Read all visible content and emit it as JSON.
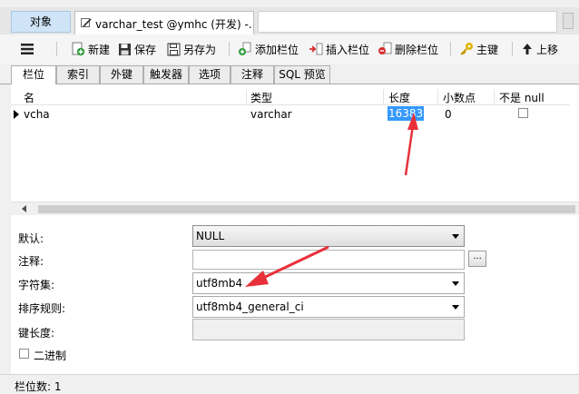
{
  "tabbar": {
    "objects_tab": "对象",
    "doc_tab": "varchar_test @ymhc (开发) -..."
  },
  "toolbar": {
    "new": "新建",
    "save": "保存",
    "save_as": "另存为",
    "add_field": "添加栏位",
    "insert_field": "插入栏位",
    "delete_field": "删除栏位",
    "primary_key": "主键",
    "move_up": "上移"
  },
  "subtabs": [
    "栏位",
    "索引",
    "外键",
    "触发器",
    "选项",
    "注释",
    "SQL 预览"
  ],
  "grid": {
    "columns": [
      "名",
      "类型",
      "长度",
      "小数点",
      "不是 null"
    ],
    "rows": [
      {
        "name": "vcha",
        "type": "varchar",
        "length": "16383",
        "decimals": "0",
        "not_null": false
      }
    ]
  },
  "properties": {
    "default_label": "默认:",
    "default_value": "NULL",
    "comment_label": "注释:",
    "comment_value": "",
    "ellipsis": "...",
    "charset_label": "字符集:",
    "charset_value": "utf8mb4",
    "collation_label": "排序规则:",
    "collation_value": "utf8mb4_general_ci",
    "key_length_label": "键长度:",
    "key_length_value": "",
    "binary_label": "二进制",
    "binary_checked": false
  },
  "statusbar": {
    "field_count": "栏位数: 1"
  },
  "colors": {
    "selection": "#3399ff",
    "annotation_arrow": "#e8303a",
    "objects_tab_bg": "#cfe5f7"
  }
}
